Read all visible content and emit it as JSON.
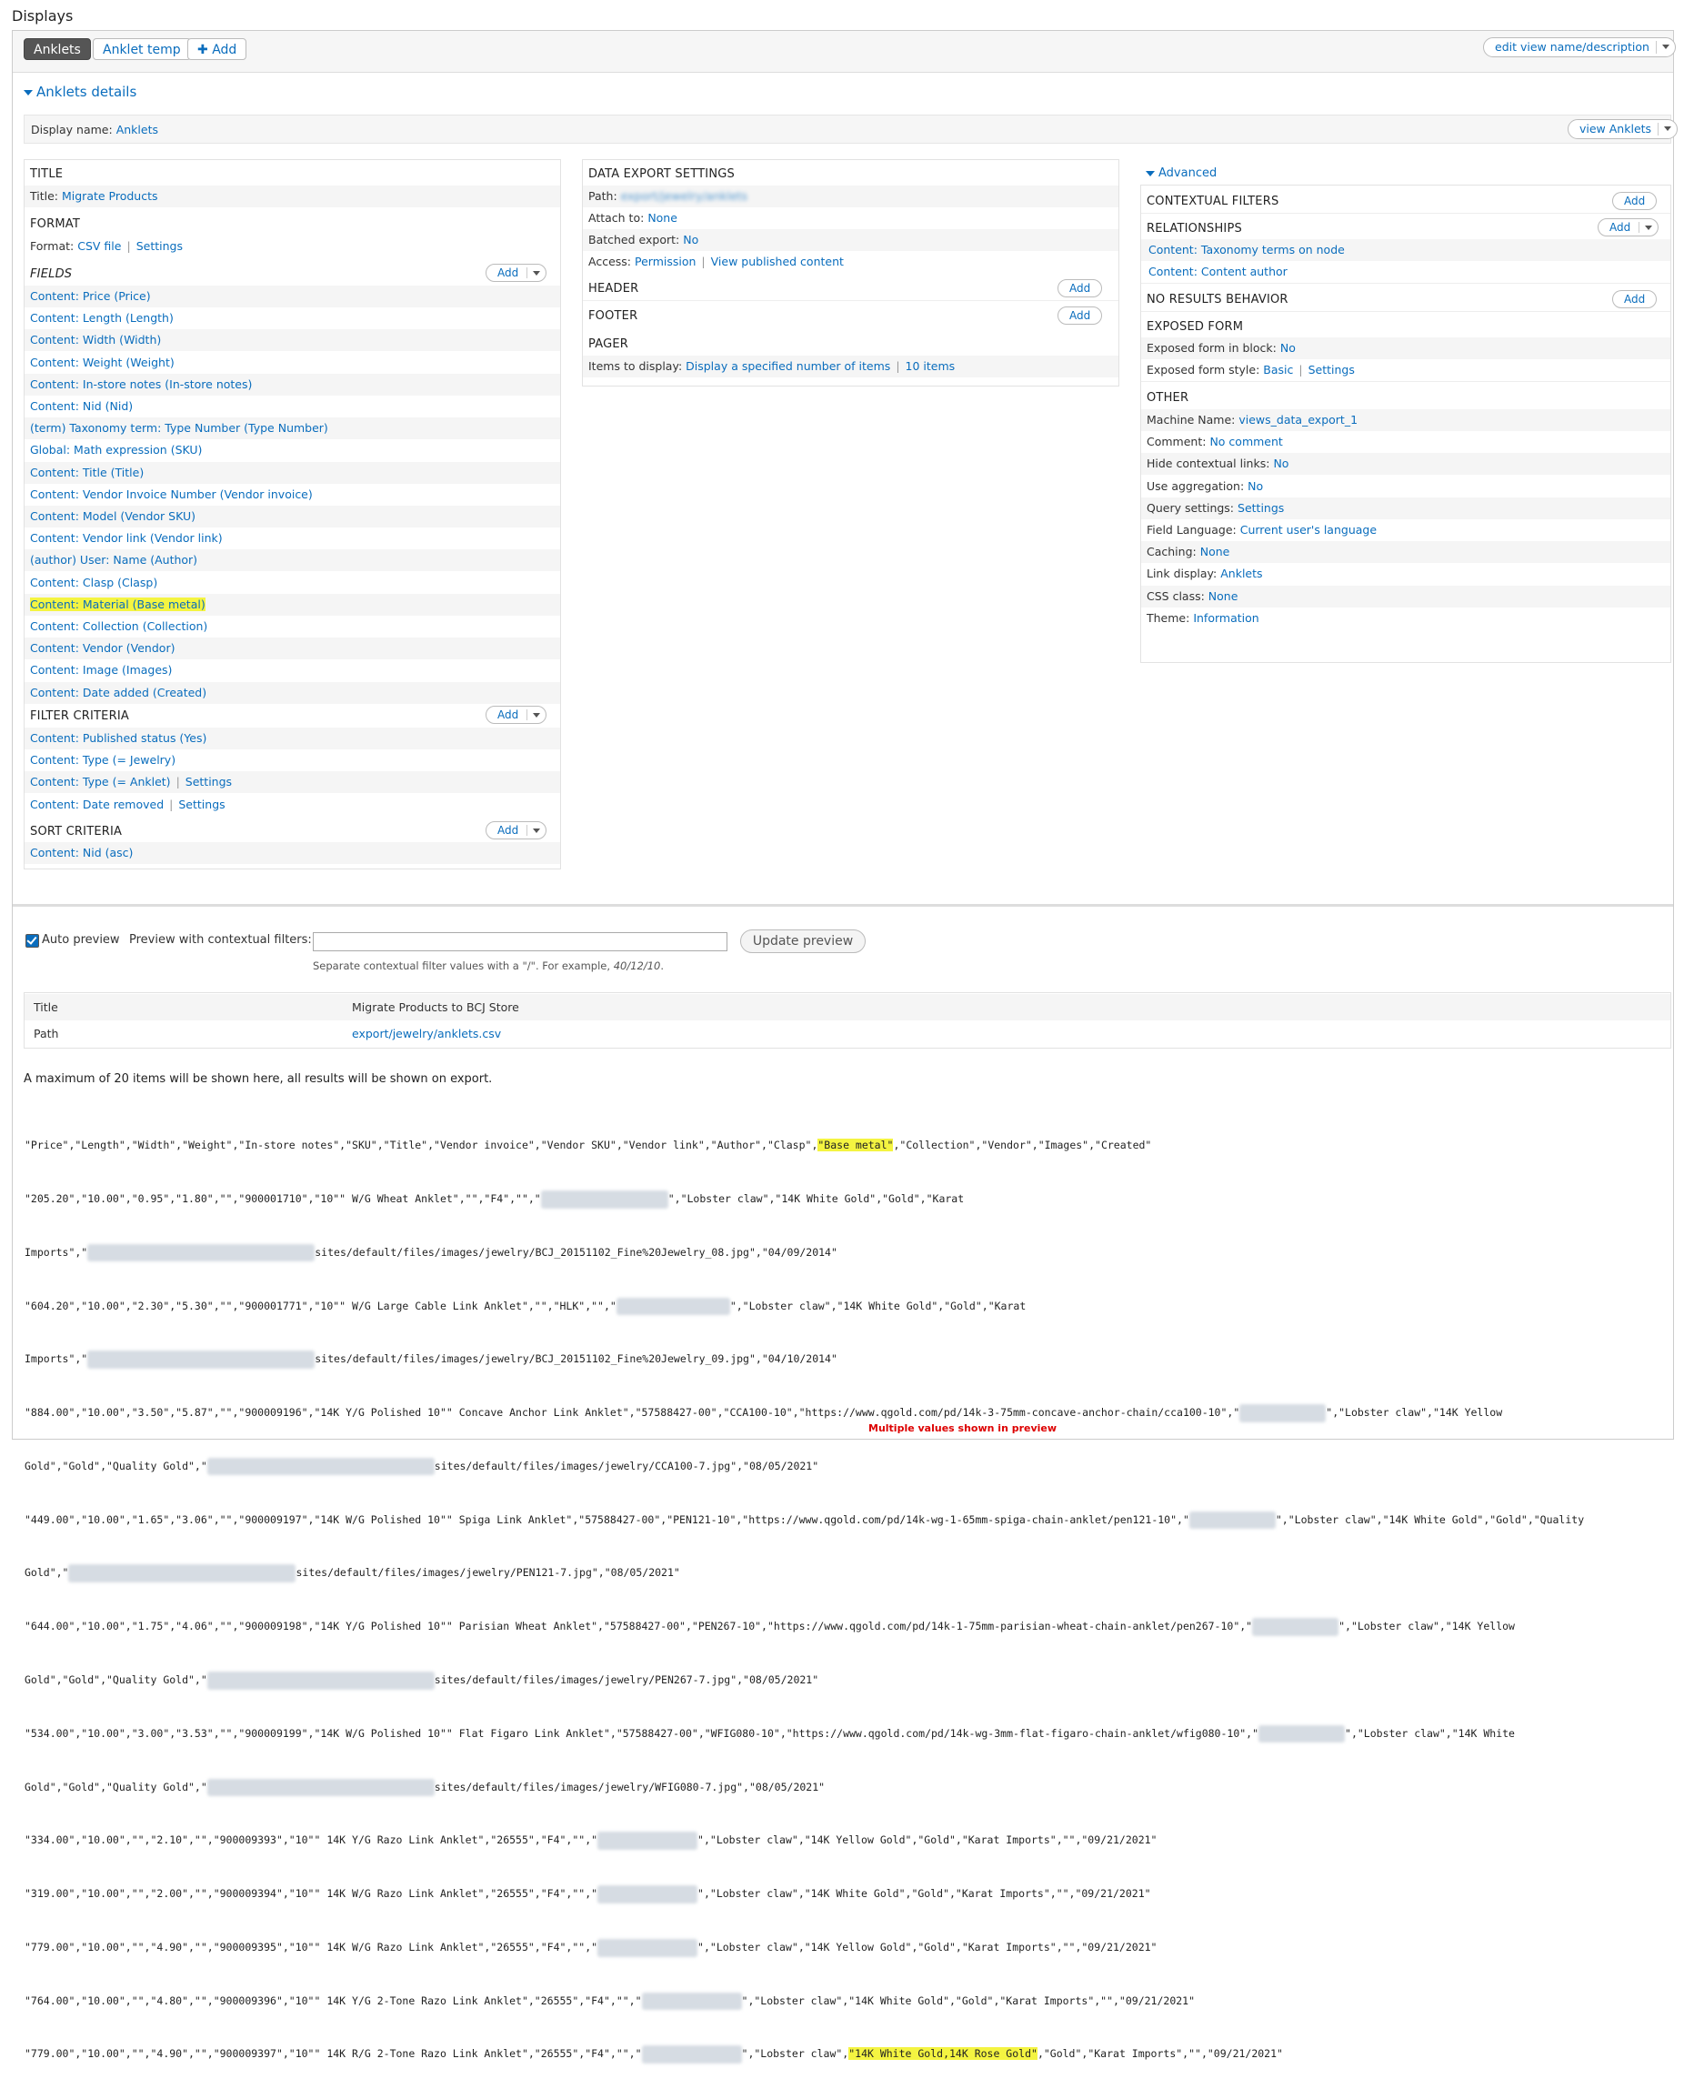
{
  "page_title": "Displays",
  "tabs": [
    {
      "label": "Anklets",
      "active": true
    },
    {
      "label": "Anklet temp",
      "active": false
    },
    {
      "label": "Add",
      "active": false
    }
  ],
  "edit_view_label": "edit view name/description",
  "details": {
    "heading": "Anklets details",
    "display_name_label": "Display name:",
    "display_name_value": "Anklets",
    "view_button": "view Anklets"
  },
  "left_col": {
    "title_head": "TITLE",
    "title_label": "Title:",
    "title_value": "Migrate Products",
    "format_head": "FORMAT",
    "format_label": "Format:",
    "format_value": "CSV file",
    "format_settings": "Settings",
    "fields_head": "FIELDS",
    "add_label": "Add",
    "fields": [
      "Content: Price (Price)",
      "Content: Length (Length)",
      "Content: Width (Width)",
      "Content: Weight (Weight)",
      "Content: In-store notes (In-store notes)",
      "Content: Nid (Nid)",
      "(term) Taxonomy term: Type Number (Type Number)",
      "Global: Math expression (SKU)",
      "Content: Title (Title)",
      "Content: Vendor Invoice Number (Vendor invoice)",
      "Content: Model (Vendor SKU)",
      "Content: Vendor link (Vendor link)",
      "(author) User: Name (Author)",
      "Content: Clasp (Clasp)",
      "Content: Material (Base metal)",
      "Content: Collection (Collection)",
      "Content: Vendor (Vendor)",
      "Content: Image (Images)",
      "Content: Date added (Created)"
    ],
    "filter_head": "FILTER CRITERIA",
    "filters": [
      {
        "text": "Content: Published status (Yes)",
        "settings": ""
      },
      {
        "text": "Content: Type (= Jewelry)",
        "settings": ""
      },
      {
        "text": "Content: Type (= Anklet)",
        "settings": "Settings"
      },
      {
        "text": "Content: Date removed",
        "settings": "Settings"
      }
    ],
    "sort_head": "SORT CRITERIA",
    "sorts": [
      "Content: Nid (asc)"
    ]
  },
  "mid_col": {
    "head": "DATA EXPORT SETTINGS",
    "path_label": "Path:",
    "path_value": "export/jewelry/anklets",
    "attach_label": "Attach to:",
    "attach_value": "None",
    "batched_label": "Batched export:",
    "batched_value": "No",
    "access_label": "Access:",
    "access_value": "Permission",
    "access_value2": "View published content",
    "header_head": "HEADER",
    "footer_head": "FOOTER",
    "pager_head": "PAGER",
    "items_label": "Items to display:",
    "items_value": "Display a specified number of items",
    "items_value2": "10 items",
    "add_label": "Add"
  },
  "right_col": {
    "advanced": "Advanced",
    "contextual_head": "CONTEXTUAL FILTERS",
    "relationships_head": "RELATIONSHIPS",
    "relationships": [
      "Content: Taxonomy terms on node",
      "Content: Content author"
    ],
    "noresults_head": "NO RESULTS BEHAVIOR",
    "exposed_head": "EXPOSED FORM",
    "exposed_block_label": "Exposed form in block:",
    "exposed_block_value": "No",
    "exposed_style_label": "Exposed form style:",
    "exposed_style_value": "Basic",
    "exposed_style_settings": "Settings",
    "other_head": "OTHER",
    "other": [
      {
        "label": "Machine Name:",
        "value": "views_data_export_1"
      },
      {
        "label": "Comment:",
        "value": "No comment"
      },
      {
        "label": "Hide contextual links:",
        "value": "No"
      },
      {
        "label": "Use aggregation:",
        "value": "No"
      },
      {
        "label": "Query settings:",
        "value": "Settings"
      },
      {
        "label": "Field Language:",
        "value": "Current user's language"
      },
      {
        "label": "Caching:",
        "value": "None"
      },
      {
        "label": "Link display:",
        "value": "Anklets"
      },
      {
        "label": "CSS class:",
        "value": "None"
      },
      {
        "label": "Theme:",
        "value": "Information"
      }
    ],
    "add_label": "Add"
  },
  "preview": {
    "auto_preview": "Auto preview",
    "contextual_label": "Preview with contextual filters:",
    "hint_prefix": "Separate contextual filter values with a \"/\". For example, ",
    "hint_example": "40/12/10",
    "hint_suffix": ".",
    "update_button": "Update preview",
    "table": [
      {
        "key": "Title",
        "value": "Migrate Products to BCJ Store"
      },
      {
        "key": "Path",
        "value": "export/jewelry/anklets.csv"
      }
    ],
    "max_note": "A maximum of 20 items will be shown here, all results will be shown on export.",
    "annotation": "Multiple values shown in preview"
  },
  "csv": {
    "header_pre": "\"Price\",\"Length\",\"Width\",\"Weight\",\"In-store notes\",\"SKU\",\"Title\",\"Vendor invoice\",\"Vendor SKU\",\"Vendor link\",\"Author\",\"Clasp\",",
    "header_hl": "\"Base metal\"",
    "header_post": ",\"Collection\",\"Vendor\",\"Images\",\"Created\"",
    "l1": "\"205.20\",\"10.00\",\"0.95\",\"1.80\",\"\",\"900001710\",\"10\"\" W/G Wheat Anklet\",\"\",\"F4\",\"\",\"",
    "l1b": "\",\"Lobster claw\",\"14K White Gold\",\"Gold\",\"Karat",
    "l2a": "Imports\",\"",
    "l2b": "sites/default/files/images/jewelry/BCJ_20151102_Fine%20Jewelry_08.jpg\",\"04/09/2014\"",
    "l3": "\"604.20\",\"10.00\",\"2.30\",\"5.30\",\"\",\"900001771\",\"10\"\" W/G Large Cable Link Anklet\",\"\",\"HLK\",\"\",\"",
    "l3b": "\",\"Lobster claw\",\"14K White Gold\",\"Gold\",\"Karat",
    "l4a": "Imports\",\"",
    "l4b": "sites/default/files/images/jewelry/BCJ_20151102_Fine%20Jewelry_09.jpg\",\"04/10/2014\"",
    "l5": "\"884.00\",\"10.00\",\"3.50\",\"5.87\",\"\",\"900009196\",\"14K Y/G Polished 10\"\" Concave Anchor Link Anklet\",\"57588427-00\",\"CCA100-10\",\"https://www.qgold.com/pd/14k-3-75mm-concave-anchor-chain/cca100-10\",\"",
    "l5b": "\",\"Lobster claw\",\"14K Yellow",
    "l6a": "Gold\",\"Gold\",\"Quality Gold\",\"",
    "l6b": "sites/default/files/images/jewelry/CCA100-7.jpg\",\"08/05/2021\"",
    "l7": "\"449.00\",\"10.00\",\"1.65\",\"3.06\",\"\",\"900009197\",\"14K W/G Polished 10\"\" Spiga Link Anklet\",\"57588427-00\",\"PEN121-10\",\"https://www.qgold.com/pd/14k-wg-1-65mm-spiga-chain-anklet/pen121-10\",\"",
    "l7b": "\",\"Lobster claw\",\"14K White Gold\",\"Gold\",\"Quality",
    "l8a": "Gold\",\"",
    "l8b": "sites/default/files/images/jewelry/PEN121-7.jpg\",\"08/05/2021\"",
    "l9": "\"644.00\",\"10.00\",\"1.75\",\"4.06\",\"\",\"900009198\",\"14K Y/G Polished 10\"\" Parisian Wheat Anklet\",\"57588427-00\",\"PEN267-10\",\"https://www.qgold.com/pd/14k-1-75mm-parisian-wheat-chain-anklet/pen267-10\",\"",
    "l9b": "\",\"Lobster claw\",\"14K Yellow",
    "l10a": "Gold\",\"Gold\",\"Quality Gold\",\"",
    "l10b": "sites/default/files/images/jewelry/PEN267-7.jpg\",\"08/05/2021\"",
    "l11": "\"534.00\",\"10.00\",\"3.00\",\"3.53\",\"\",\"900009199\",\"14K W/G Polished 10\"\" Flat Figaro Link Anklet\",\"57588427-00\",\"WFIG080-10\",\"https://www.qgold.com/pd/14k-wg-3mm-flat-figaro-chain-anklet/wfig080-10\",\"",
    "l11b": "\",\"Lobster claw\",\"14K White",
    "l12a": "Gold\",\"Gold\",\"Quality Gold\",\"",
    "l12b": "sites/default/files/images/jewelry/WFIG080-7.jpg\",\"08/05/2021\"",
    "l13": "\"334.00\",\"10.00\",\"\",\"2.10\",\"\",\"900009393\",\"10\"\" 14K Y/G Razo Link Anklet\",\"26555\",\"F4\",\"\",\"",
    "l13b": "\",\"Lobster claw\",\"14K Yellow Gold\",\"Gold\",\"Karat Imports\",\"\",\"09/21/2021\"",
    "l14": "\"319.00\",\"10.00\",\"\",\"2.00\",\"\",\"900009394\",\"10\"\" 14K W/G Razo Link Anklet\",\"26555\",\"F4\",\"\",\"",
    "l14b": "\",\"Lobster claw\",\"14K White Gold\",\"Gold\",\"Karat Imports\",\"\",\"09/21/2021\"",
    "l15": "\"779.00\",\"10.00\",\"\",\"4.90\",\"\",\"900009395\",\"10\"\" 14K W/G Razo Link Anklet\",\"26555\",\"F4\",\"\",\"",
    "l15b": "\",\"Lobster claw\",\"14K Yellow Gold\",\"Gold\",\"Karat Imports\",\"\",\"09/21/2021\"",
    "l16": "\"764.00\",\"10.00\",\"\",\"4.80\",\"\",\"900009396\",\"10\"\" 14K Y/G 2-Tone Razo Link Anklet\",\"26555\",\"F4\",\"\",\"",
    "l16b": "\",\"Lobster claw\",\"14K White Gold\",\"Gold\",\"Karat Imports\",\"\",\"09/21/2021\"",
    "l17": "\"779.00\",\"10.00\",\"\",\"4.90\",\"\",\"900009397\",\"10\"\" 14K R/G 2-Tone Razo Link Anklet\",\"26555\",\"F4\",\"\",\"",
    "l17b": "\",\"Lobster claw\",",
    "l17hl": "\"14K White Gold,14K Rose Gold\"",
    "l17c": ",\"Gold\",\"Karat Imports\",\"\",\"09/21/2021\""
  }
}
